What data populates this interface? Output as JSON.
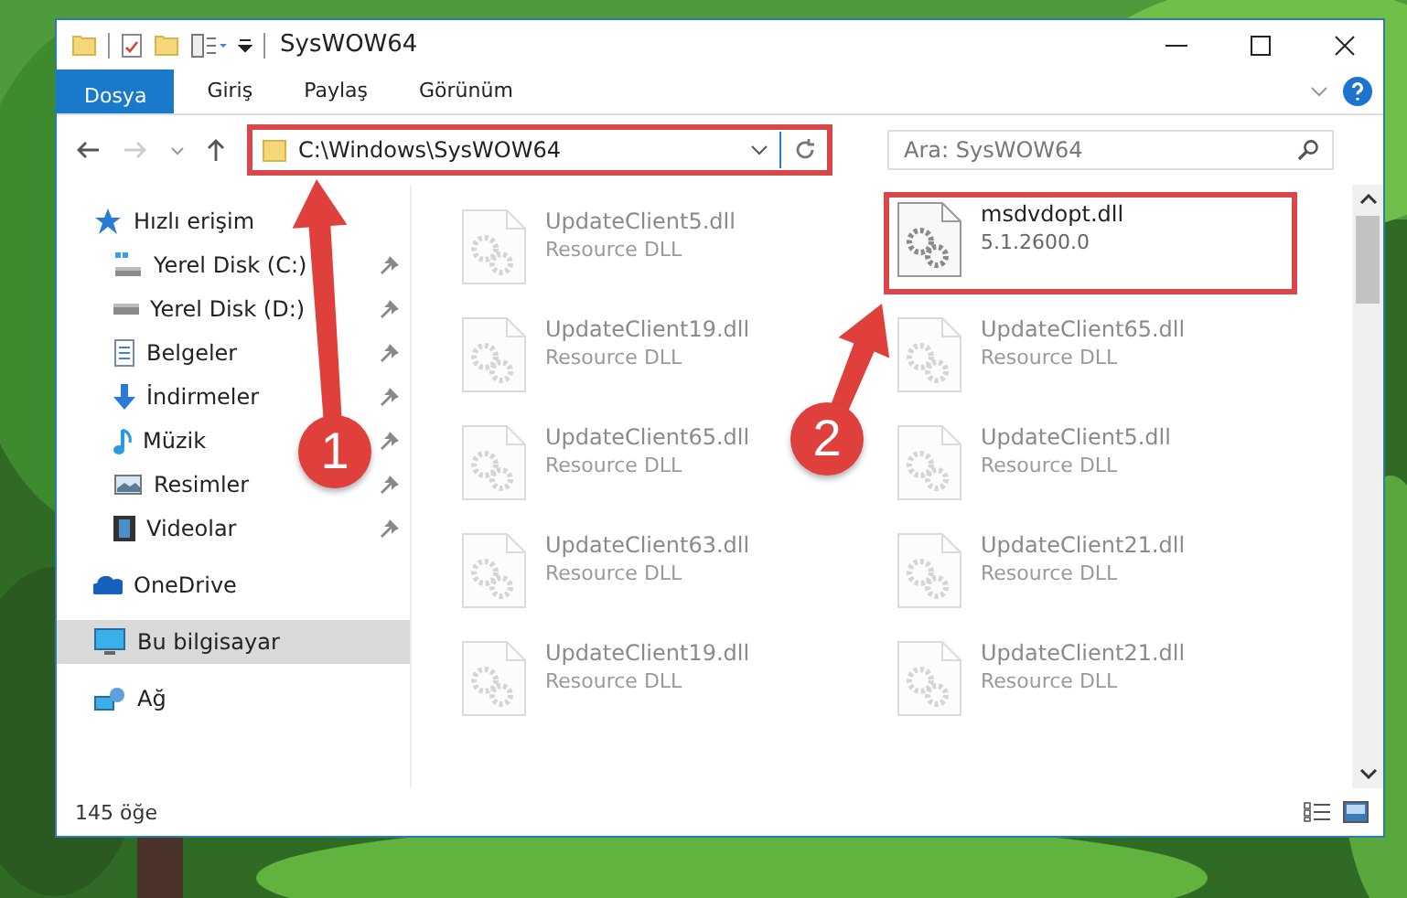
{
  "window": {
    "title": "SysWOW64"
  },
  "ribbon_tabs": [
    {
      "label": "Dosya",
      "kind": "file"
    },
    {
      "label": "Giriş",
      "kind": "tab"
    },
    {
      "label": "Paylaş",
      "kind": "tab"
    },
    {
      "label": "Görünüm",
      "kind": "tab"
    }
  ],
  "address_bar": {
    "path": "C:\\Windows\\SysWOW64",
    "highlighted": true
  },
  "search": {
    "placeholder": "Ara: SysWOW64"
  },
  "sidebar": {
    "items": [
      {
        "label": "Hızlı erişim",
        "kind": "star",
        "selected": false,
        "children": [
          {
            "label": "Yerel Disk (C:)",
            "kind": "system-drive",
            "pinned": true,
            "selected": false
          },
          {
            "label": "Yerel Disk (D:)",
            "kind": "drive",
            "pinned": true,
            "selected": false
          },
          {
            "label": "Belgeler",
            "kind": "documents",
            "pinned": true,
            "selected": false
          },
          {
            "label": "İndirmeler",
            "kind": "downloads",
            "pinned": true,
            "selected": false
          },
          {
            "label": "Müzik",
            "kind": "music",
            "pinned": true,
            "selected": false
          },
          {
            "label": "Resimler",
            "kind": "pictures",
            "pinned": true,
            "selected": false
          },
          {
            "label": "Videolar",
            "kind": "videos",
            "pinned": true,
            "selected": false
          }
        ]
      },
      {
        "label": "OneDrive",
        "kind": "cloud",
        "selected": false
      },
      {
        "label": "Bu bilgisayar",
        "kind": "computer",
        "selected": true
      },
      {
        "label": "Ağ",
        "kind": "network",
        "selected": false
      }
    ]
  },
  "files": [
    {
      "name": "UpdateClient5.dll",
      "detail": "Resource DLL",
      "faded": true,
      "highlighted": false
    },
    {
      "name": "msdvdopt.dll",
      "detail": "5.1.2600.0",
      "faded": false,
      "highlighted": true
    },
    {
      "name": "UpdateClient19.dll",
      "detail": "Resource DLL",
      "faded": true,
      "highlighted": false
    },
    {
      "name": "UpdateClient65.dll",
      "detail": "Resource DLL",
      "faded": true,
      "highlighted": false
    },
    {
      "name": "UpdateClient65.dll",
      "detail": "Resource DLL",
      "faded": true,
      "highlighted": false
    },
    {
      "name": "UpdateClient5.dll",
      "detail": "Resource DLL",
      "faded": true,
      "highlighted": false
    },
    {
      "name": "UpdateClient63.dll",
      "detail": "Resource DLL",
      "faded": true,
      "highlighted": false
    },
    {
      "name": "UpdateClient21.dll",
      "detail": "Resource DLL",
      "faded": true,
      "highlighted": false
    },
    {
      "name": "UpdateClient19.dll",
      "detail": "Resource DLL",
      "faded": true,
      "highlighted": false
    },
    {
      "name": "UpdateClient21.dll",
      "detail": "Resource DLL",
      "faded": true,
      "highlighted": false
    }
  ],
  "callouts": [
    {
      "number": "1"
    },
    {
      "number": "2"
    }
  ],
  "status_bar": {
    "count": "145 öğe"
  }
}
